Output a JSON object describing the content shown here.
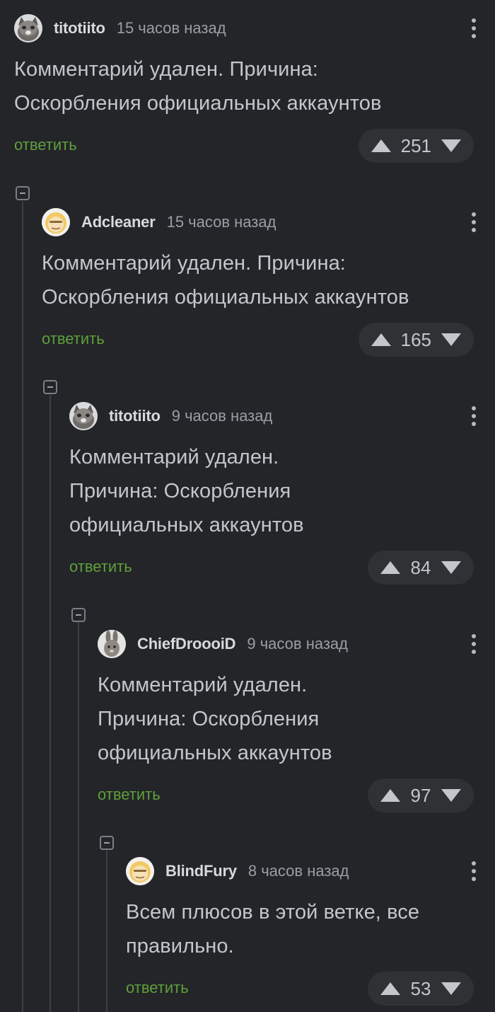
{
  "reply_label": "ответить",
  "comments": [
    {
      "username": "titotiito",
      "time": "15 часов назад",
      "text_lines": [
        "Комментарий удален. Причина:",
        "Оскорбления официальных аккаунтов"
      ],
      "votes": "251",
      "avatar": "cat-avatar"
    },
    {
      "username": "Adcleaner",
      "time": "15 часов назад",
      "text_lines": [
        "Комментарий удален. Причина:",
        "Оскорбления официальных аккаунтов"
      ],
      "votes": "165",
      "avatar": "cartoon-face-avatar"
    },
    {
      "username": "titotiito",
      "time": "9 часов назад",
      "text_lines": [
        "Комментарий удален.",
        "Причина: Оскорбления",
        "официальных аккаунтов"
      ],
      "votes": "84",
      "avatar": "cat-avatar"
    },
    {
      "username": "ChiefDroooiD",
      "time": "9 часов назад",
      "text_lines": [
        "Комментарий удален.",
        "Причина: Оскорбления",
        "официальных аккаунтов"
      ],
      "votes": "97",
      "avatar": "rabbit-avatar"
    },
    {
      "username": "BlindFury",
      "time": "8 часов назад",
      "text_lines": [
        "Всем плюсов в этой ветке, все",
        "правильно."
      ],
      "votes": "53",
      "avatar": "cartoon-face-avatar"
    }
  ],
  "colors": {
    "background": "#232528",
    "reply_link": "#5f9f3b",
    "vote_pill": "#2f3135"
  }
}
